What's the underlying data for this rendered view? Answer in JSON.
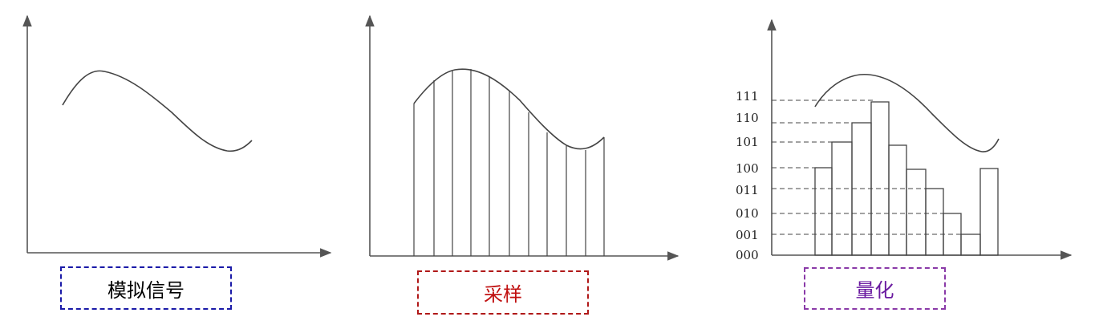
{
  "panels": [
    {
      "caption": "模拟信号",
      "caption_color": "#1a1aa8"
    },
    {
      "caption": "采样",
      "caption_color": "#b01818"
    },
    {
      "caption": "量化",
      "caption_color": "#8a3aa8"
    }
  ],
  "quantization_levels": [
    "111",
    "110",
    "101",
    "100",
    "011",
    "010",
    "001",
    "000"
  ],
  "colors": {
    "line": "#333333",
    "dashed": "#444444"
  }
}
